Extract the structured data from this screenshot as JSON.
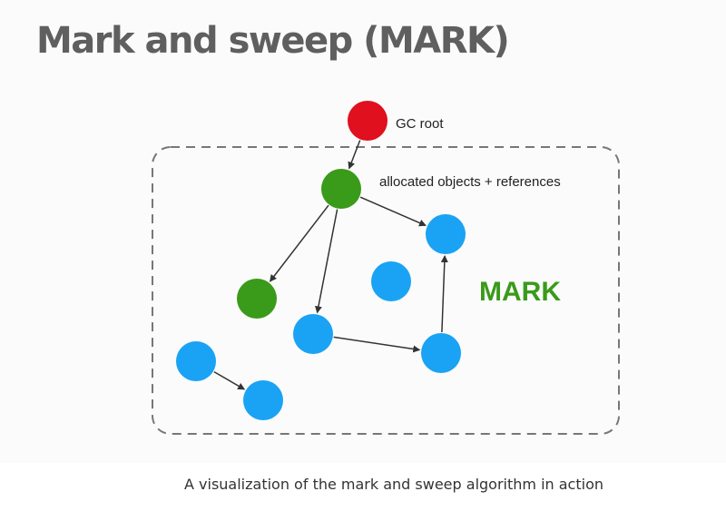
{
  "slide": {
    "title": "Mark and sweep (MARK)"
  },
  "diagram": {
    "labels": {
      "gc_root": "GC root",
      "allocated": "allocated objects + references",
      "phase": "MARK"
    },
    "nodes": [
      {
        "id": "root",
        "kind": "gc-root",
        "color": "#e0101e"
      },
      {
        "id": "a",
        "kind": "marked",
        "color": "#3a9a1a"
      },
      {
        "id": "b",
        "kind": "marked",
        "color": "#3a9a1a"
      },
      {
        "id": "c",
        "kind": "unmarked",
        "color": "#1aa3f4"
      },
      {
        "id": "d",
        "kind": "unmarked",
        "color": "#1aa3f4"
      },
      {
        "id": "e",
        "kind": "unmarked",
        "color": "#1aa3f4"
      },
      {
        "id": "f",
        "kind": "unmarked",
        "color": "#1aa3f4"
      },
      {
        "id": "g",
        "kind": "unmarked",
        "color": "#1aa3f4"
      },
      {
        "id": "h",
        "kind": "unmarked",
        "color": "#1aa3f4"
      }
    ],
    "edges": [
      {
        "from": "root",
        "to": "a"
      },
      {
        "from": "a",
        "to": "c"
      },
      {
        "from": "a",
        "to": "b"
      },
      {
        "from": "a",
        "to": "e"
      },
      {
        "from": "e",
        "to": "f"
      },
      {
        "from": "f",
        "to": "c"
      },
      {
        "from": "g",
        "to": "h"
      }
    ],
    "colors": {
      "phase_text": "#3a9a1a",
      "boundary": "#777777",
      "arrow": "#333333"
    }
  },
  "caption": "A visualization of the mark and sweep algorithm in action"
}
